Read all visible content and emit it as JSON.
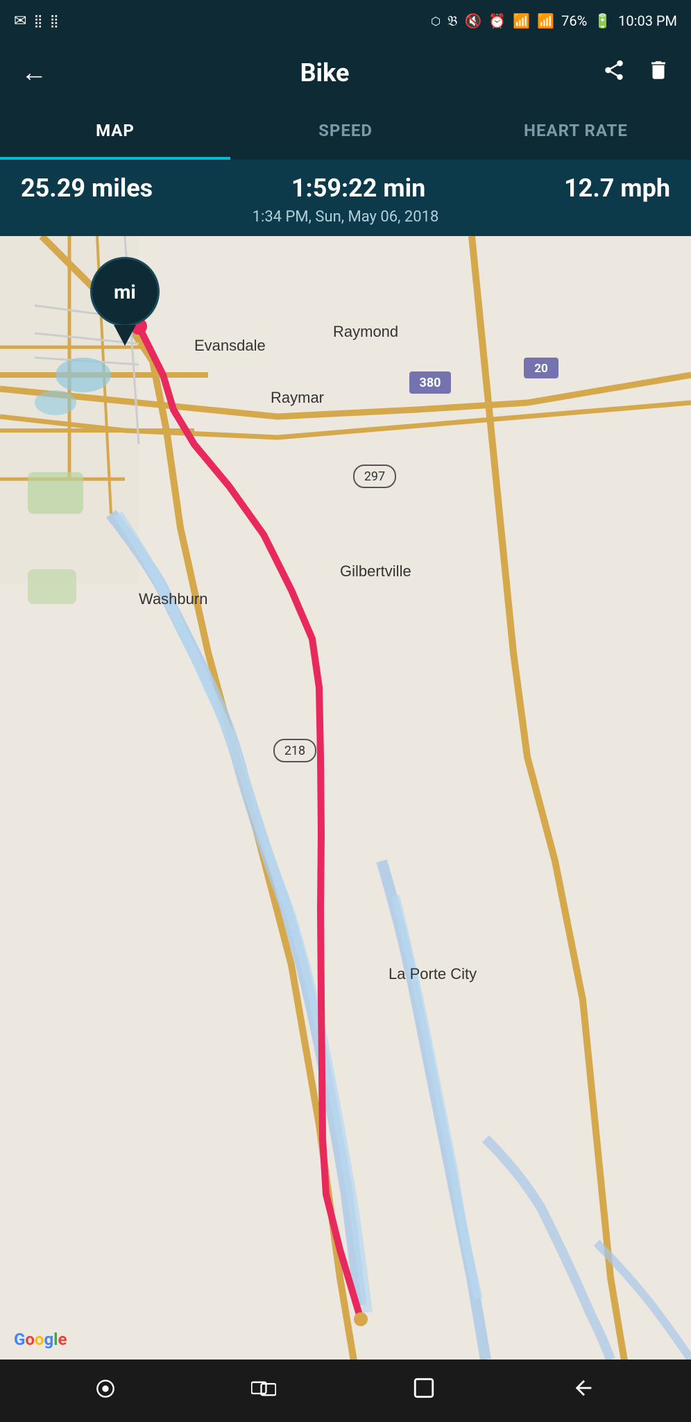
{
  "statusBar": {
    "leftIcons": [
      "mail",
      "grid-dots",
      "grid-dots-2"
    ],
    "battery": "76%",
    "time": "10:03 PM",
    "rightIcons": [
      "battery-saver",
      "bluetooth",
      "mute",
      "alarm",
      "wifi",
      "signal"
    ]
  },
  "appBar": {
    "backLabel": "←",
    "title": "Bike",
    "shareIcon": "share",
    "deleteIcon": "delete"
  },
  "tabs": [
    {
      "label": "MAP",
      "active": true
    },
    {
      "label": "SPEED",
      "active": false
    },
    {
      "label": "HEART RATE",
      "active": false
    }
  ],
  "stats": {
    "distance": "25.29 miles",
    "duration": "1:59:22 min",
    "speed": "12.7 mph",
    "datetime": "1:34 PM, Sun, May 06, 2018"
  },
  "map": {
    "markerLabel": "mi",
    "placenames": [
      "Evansdale",
      "Raymond",
      "Raymar",
      "Washburn",
      "Gilbertville",
      "La Porte City"
    ],
    "highways": [
      "380",
      "297",
      "218",
      "20"
    ],
    "googleLogo": "Google"
  },
  "bottomNav": {
    "buttons": [
      "circle",
      "recents",
      "home-square",
      "back-arrow"
    ]
  }
}
